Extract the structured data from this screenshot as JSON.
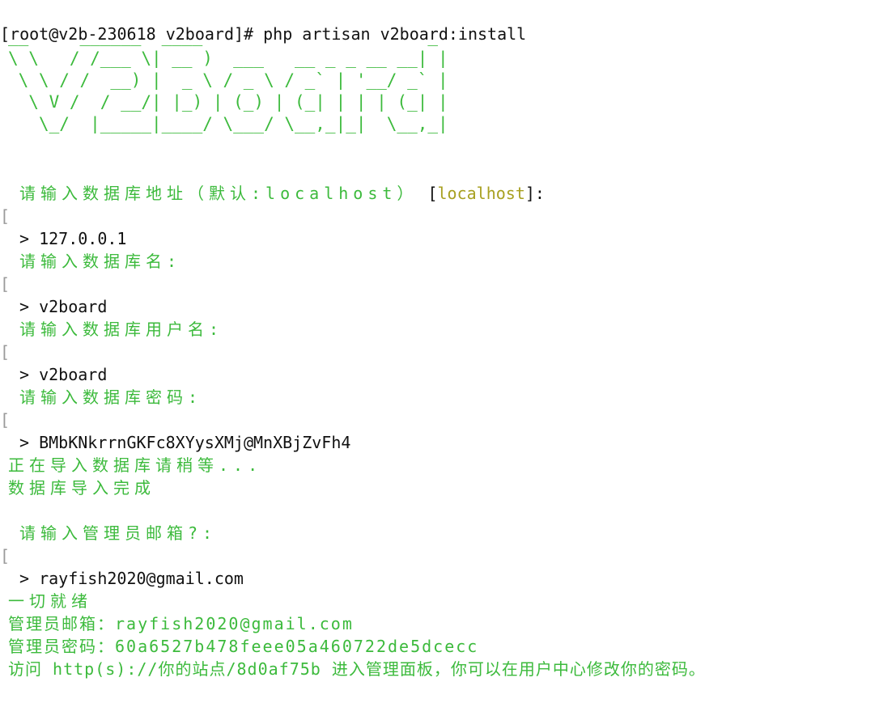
{
  "terminal": {
    "command_line": "[root@v2b-230618 v2board]# php artisan v2board:install",
    "banner": [
      "__     ______  ____                      _",
      "\\ \\   / /___ \\| __ )  ___   __ _ _ __ __| |",
      " \\ \\ / /  __) |  _ \\ / _ \\ / _` | '__/ _` |",
      "  \\ V /  / __/| |_) | (_) | (_| | | | (_| |",
      "   \\_/  |_____|____/ \\___/ \\__,_|_|  \\__,_|"
    ],
    "prompt_marker": "[",
    "q_db_host": "请输入数据库地址（默认:localhost）",
    "q_db_host_default_open": " [",
    "q_db_host_default": "localhost",
    "q_db_host_default_close": "]:",
    "a_db_host": "> 127.0.0.1",
    "q_db_name": "请输入数据库名:",
    "a_db_name": "> v2board",
    "q_db_user": "请输入数据库用户名:",
    "a_db_user": "> v2board",
    "q_db_pass": "请输入数据库密码:",
    "a_db_pass": "> BMbKNkrrnGKFc8XYysXMj@MnXBjZvFh4",
    "importing": "正在导入数据库请稍等...",
    "import_done": "数据库导入完成",
    "q_admin_email": "请输入管理员邮箱?:",
    "a_admin_email": "> rayfish2020@gmail.com",
    "ready": "一切就绪",
    "admin_email_line": "管理员邮箱：rayfish2020@gmail.com",
    "admin_pass_line": "管理员密码：60a6527b478feee05a460722de5dcecc",
    "visit_line": "访问 http(s)://你的站点/8d0af75b 进入管理面板，你可以在用户中心修改你的密码。"
  },
  "colors": {
    "background": "#ffffff",
    "text": "#111111",
    "green": "#3cba3c",
    "olive": "#a8a021",
    "gutter": "#9a9a9a"
  }
}
